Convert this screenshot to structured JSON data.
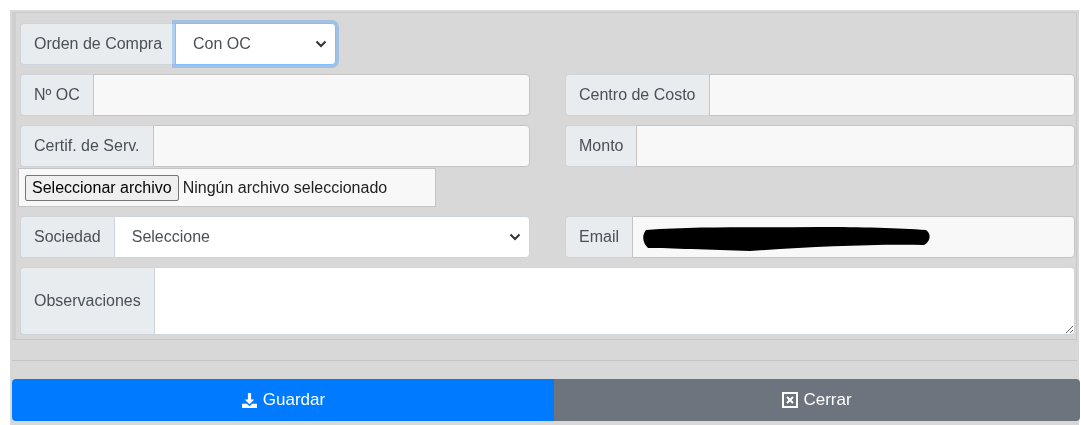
{
  "form": {
    "orden_de_compra": {
      "label": "Orden de Compra",
      "value": "Con OC",
      "focused": true
    },
    "field_rows": [
      [
        {
          "kind": "text",
          "label": "Nº OC"
        },
        {
          "kind": "text",
          "label": "Centro de Costo"
        }
      ],
      [
        {
          "kind": "text",
          "label": "Certif. de Serv."
        },
        {
          "kind": "text",
          "label": "Monto"
        }
      ]
    ],
    "file_picker": {
      "button": "Seleccionar archivo",
      "status": "Ningún archivo seleccionado"
    },
    "sociedad": {
      "label": "Sociedad",
      "value": "Seleccione"
    },
    "email": {
      "label": "Email",
      "redacted": true
    },
    "observaciones": {
      "label": "Observaciones"
    }
  },
  "buttons": [
    {
      "kind": "primary",
      "label": "Guardar"
    },
    {
      "kind": "secondary",
      "label": "Cerrar"
    }
  ]
}
